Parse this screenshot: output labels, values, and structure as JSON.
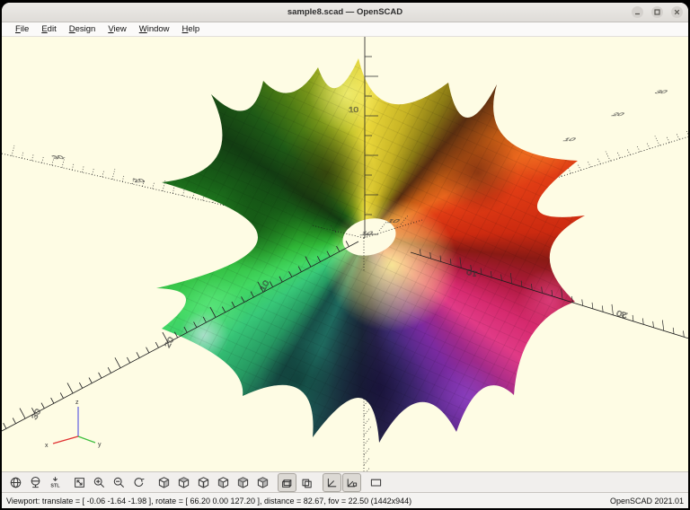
{
  "window": {
    "title": "sample8.scad — OpenSCAD",
    "controls": [
      {
        "name": "minimize"
      },
      {
        "name": "maximize"
      },
      {
        "name": "close"
      }
    ]
  },
  "menu": {
    "items": [
      "File",
      "Edit",
      "Design",
      "View",
      "Window",
      "Help"
    ]
  },
  "toolbar": {
    "buttons": [
      {
        "name": "preview",
        "pressed": false
      },
      {
        "name": "render",
        "pressed": false
      },
      {
        "name": "export-stl",
        "pressed": false,
        "label": "STL"
      },
      {
        "name": "zoom-all",
        "pressed": false,
        "gap": true
      },
      {
        "name": "zoom-in",
        "pressed": false
      },
      {
        "name": "zoom-out",
        "pressed": false
      },
      {
        "name": "reset-view",
        "pressed": false
      },
      {
        "name": "view-right",
        "pressed": false,
        "gap": true
      },
      {
        "name": "view-top",
        "pressed": false
      },
      {
        "name": "view-bottom",
        "pressed": false
      },
      {
        "name": "view-left",
        "pressed": false
      },
      {
        "name": "view-front",
        "pressed": false
      },
      {
        "name": "view-back",
        "pressed": false
      },
      {
        "name": "view-diagonal",
        "pressed": true,
        "gap": true
      },
      {
        "name": "view-center",
        "pressed": false
      },
      {
        "name": "perspective",
        "pressed": true,
        "gap": true
      },
      {
        "name": "orthogonal",
        "pressed": true
      },
      {
        "name": "view-all-rect",
        "pressed": false,
        "gap": true
      }
    ]
  },
  "viewport": {
    "background_color": "#FEFCE4",
    "gizmo": {
      "x": "x",
      "y": "y",
      "z": "z"
    },
    "axis_labels": {
      "ten": "10",
      "twenty": "20",
      "thirty": "30"
    },
    "axis_colors": {
      "x": "#e03030",
      "y": "#3fbf3f",
      "z": "#6060e0"
    }
  },
  "statusbar": {
    "viewport_text": "Viewport: translate = [ -0.06 -1.64 -1.98 ], rotate = [ 66.20 0.00 127.20 ], distance = 82.67, fov = 22.50 (1442x944)",
    "version": "OpenSCAD 2021.01"
  }
}
